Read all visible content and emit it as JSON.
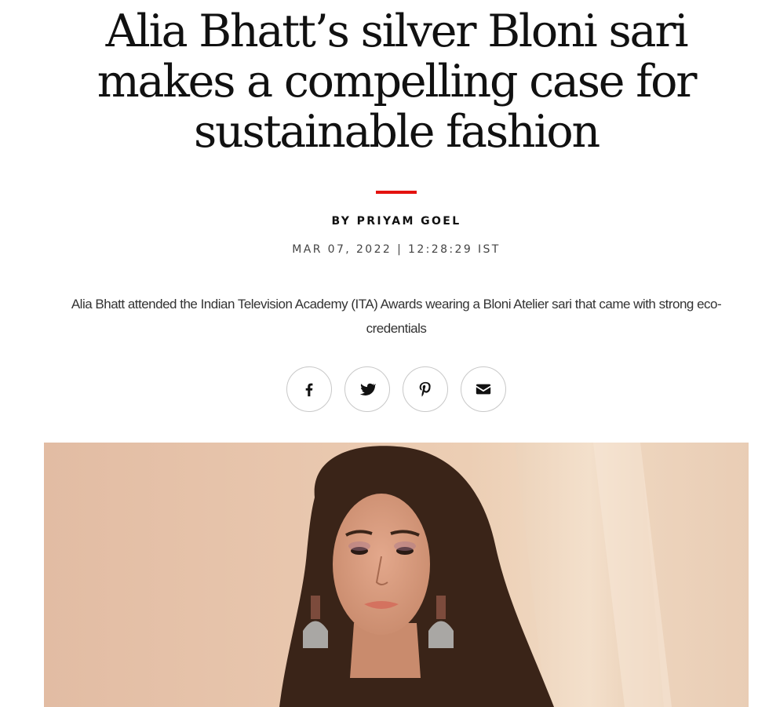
{
  "article": {
    "title": "Alia Bhatt’s silver Bloni sari makes a compelling case for sustainable fashion",
    "byline_prefix": "BY",
    "author": "PRIYAM GOEL",
    "date": "MAR 07, 2022 | 12:28:29 IST",
    "dek": "Alia Bhatt attended the Indian Television Academy (ITA) Awards wearing a Bloni Atelier sari that came with strong eco-credentials"
  },
  "share": {
    "buttons": [
      {
        "name": "facebook",
        "icon": "facebook-icon"
      },
      {
        "name": "twitter",
        "icon": "twitter-icon"
      },
      {
        "name": "pinterest",
        "icon": "pinterest-icon"
      },
      {
        "name": "email",
        "icon": "envelope-icon"
      }
    ]
  },
  "colors": {
    "accent": "#e4120f",
    "text": "#111111",
    "muted": "#444444",
    "backdrop": "#e8c6ad"
  }
}
